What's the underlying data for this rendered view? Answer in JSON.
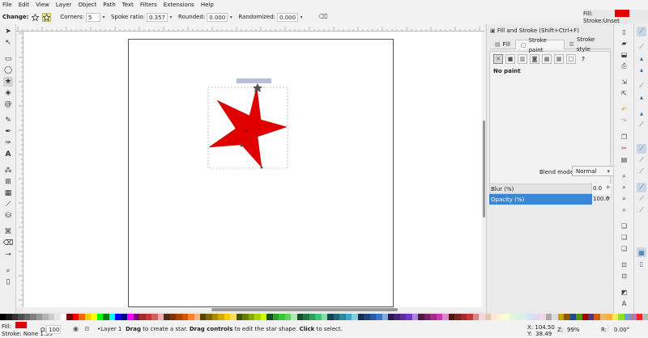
{
  "menu": [
    "File",
    "Edit",
    "View",
    "Layer",
    "Object",
    "Path",
    "Text",
    "Filters",
    "Extensions",
    "Help"
  ],
  "fill_indicator": {
    "fill_label": "Fill:",
    "stroke_label": "Stroke:",
    "stroke_value": "Unset",
    "fill_color": "#e00000"
  },
  "controls": {
    "change_label": "Change:",
    "corners_label": "Corners:",
    "corners_value": "5",
    "spoke_label": "Spoke ratio:",
    "spoke_value": "0.357",
    "rounded_label": "Rounded:",
    "rounded_value": "0.000",
    "randomized_label": "Randomized:",
    "randomized_value": "0.000"
  },
  "canvas": {
    "selection_tag": "Star tool  Star shape",
    "star_fill": "#e00000"
  },
  "dock": {
    "title": "Fill and Stroke (Shift+Ctrl+F)",
    "tabs": [
      "Fill",
      "Stroke paint",
      "Stroke style"
    ],
    "active_tab": "Stroke paint",
    "no_paint": "No paint",
    "blend_label": "Blend mode:",
    "blend_value": "Normal",
    "blur_label": "Blur (%)",
    "blur_value": "0.0",
    "opacity_label": "Opacity (%)",
    "opacity_value": "100.0"
  },
  "status": {
    "fill_label": "Fill:",
    "stroke_text": "Stroke: None 1.39",
    "opacity_label": "O:",
    "opacity_value": "100",
    "layer_label": "•Layer 1",
    "message_b1": "Drag",
    "message_t1": " to create a star. ",
    "message_b2": "Drag controls",
    "message_t2": " to edit the star shape. ",
    "message_b3": "Click",
    "message_t3": " to select.",
    "x_label": "X:",
    "x_value": "104.50",
    "y_label": "Y:",
    "y_value": "38.49",
    "zoom_label": "Z:",
    "zoom_value": "99%",
    "rot_label": "R:",
    "rot_value": "0.00°"
  },
  "palette_colors": [
    "#000000",
    "#1a1a1a",
    "#333333",
    "#4d4d4d",
    "#666666",
    "#808080",
    "#999999",
    "#b3b3b3",
    "#cccccc",
    "#e6e6e6",
    "#ffffff",
    "#800000",
    "#ff0000",
    "#ff6600",
    "#ffcc00",
    "#ffff00",
    "#00ff00",
    "#008000",
    "#00ffff",
    "#0000ff",
    "#000080",
    "#ff00ff",
    "#800080",
    "#a02c2c",
    "#c83737",
    "#d35f5f",
    "#e9afaf",
    "#502d16",
    "#803300",
    "#aa4400",
    "#d45500",
    "#ff7f2a",
    "#ffb380",
    "#554400",
    "#806600",
    "#aa8800",
    "#d4aa00",
    "#ffcc00",
    "#ffdd55",
    "#445500",
    "#668000",
    "#88aa00",
    "#aad400",
    "#ccff00",
    "#165016",
    "#2ca02c",
    "#37c837",
    "#5fd35f",
    "#afe9af",
    "#16502d",
    "#217844",
    "#2ca05a",
    "#37c871",
    "#87deaa",
    "#164450",
    "#216778",
    "#2c89a0",
    "#37abc8",
    "#87cdde",
    "#162d50",
    "#214478",
    "#2c5aa0",
    "#3771c8",
    "#87aade",
    "#2d1650",
    "#442178",
    "#5a2ca0",
    "#7137c8",
    "#aa87de",
    "#501644",
    "#782167",
    "#a02c89",
    "#c837ab",
    "#de87cd",
    "#501616",
    "#782121",
    "#a02c2c",
    "#c83737",
    "#de8787",
    "#f4d7d7",
    "#e9c6af",
    "#ffe6d5",
    "#fff6d5",
    "#f6ffd5",
    "#e3f4d7",
    "#d7f4e3",
    "#d7eef4",
    "#d7e3f4",
    "#e3d7f4",
    "#f4d7ee",
    "#aaaaaa",
    "#dddddd",
    "#c4a000",
    "#8f5902",
    "#204a87",
    "#4e9a06",
    "#a40000",
    "#5c3566",
    "#ce5c00",
    "#e9b96e",
    "#fcaf3e",
    "#fce94f",
    "#8ae234",
    "#729fcf",
    "#ad7fa8",
    "#ef2929",
    "#babdb6"
  ]
}
